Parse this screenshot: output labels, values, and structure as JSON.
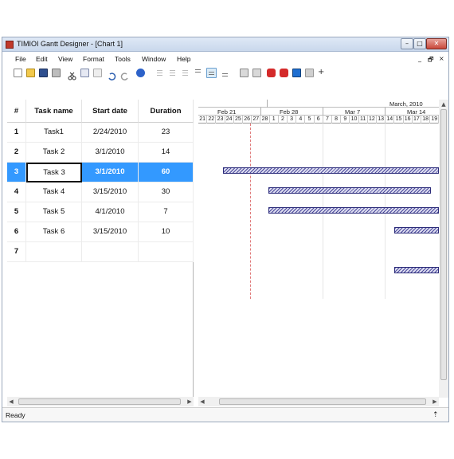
{
  "window": {
    "title": "TIMIOI Gantt Designer - [Chart 1]",
    "controls": {
      "minimize": "–",
      "maximize": "□",
      "close": "✕"
    }
  },
  "menu": {
    "items": [
      "File",
      "Edit",
      "View",
      "Format",
      "Tools",
      "Window",
      "Help"
    ],
    "mdi_controls": {
      "minimize": "_",
      "restore": "🗗",
      "close": "×"
    }
  },
  "table": {
    "columns": [
      "#",
      "Task name",
      "Start date",
      "Duration"
    ],
    "rows": [
      {
        "num": "1",
        "name": "Task1",
        "start": "2/24/2010",
        "duration": "23"
      },
      {
        "num": "2",
        "name": "Task 2",
        "start": "3/1/2010",
        "duration": "14"
      },
      {
        "num": "3",
        "name": "Task 3",
        "start": "3/1/2010",
        "duration": "60"
      },
      {
        "num": "4",
        "name": "Task 4",
        "start": "3/15/2010",
        "duration": "30"
      },
      {
        "num": "5",
        "name": "Task 5",
        "start": "4/1/2010",
        "duration": "7"
      },
      {
        "num": "6",
        "name": "Task 6",
        "start": "3/15/2010",
        "duration": "10"
      },
      {
        "num": "7",
        "name": "",
        "start": "",
        "duration": ""
      }
    ],
    "selected_row": 3
  },
  "gantt": {
    "month_label": "March, 2010",
    "weeks": [
      "Feb 21",
      "Feb 28",
      "Mar 7",
      "Mar 14"
    ],
    "days": [
      "21",
      "22",
      "23",
      "24",
      "25",
      "26",
      "27",
      "28",
      "1",
      "2",
      "3",
      "4",
      "5",
      "6",
      "7",
      "8",
      "9",
      "10",
      "11",
      "12",
      "13",
      "14",
      "15",
      "16",
      "17",
      "18",
      "19"
    ],
    "bar_color": "#4a4a9a"
  },
  "status": {
    "text": "Ready"
  },
  "colors": {
    "selection": "#3399ff",
    "titlebar": "#dfe9f6"
  }
}
